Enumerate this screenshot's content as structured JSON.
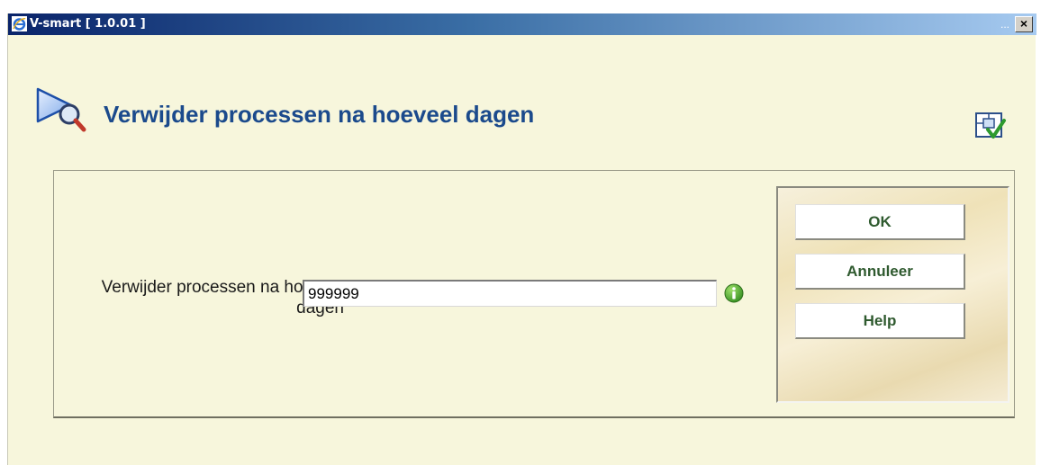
{
  "window": {
    "title": "V-smart [ 1.0.01 ]",
    "minimize_dots": "...",
    "close_symbol": "×"
  },
  "header": {
    "title": "Verwijder processen na hoeveel dagen"
  },
  "form": {
    "field_label": "Verwijder processen na hoeveel dagen",
    "field_value": "999999"
  },
  "buttons": {
    "ok": "OK",
    "cancel": "Annuleer",
    "help": "Help"
  },
  "colors": {
    "background": "#f7f6dc",
    "title_text": "#1b4a8c",
    "button_text": "#2f5a2f"
  },
  "icons": {
    "app": "ie-browser-icon",
    "header": "search-arrow-icon",
    "corner": "layout-check-icon",
    "info": "info-icon"
  }
}
